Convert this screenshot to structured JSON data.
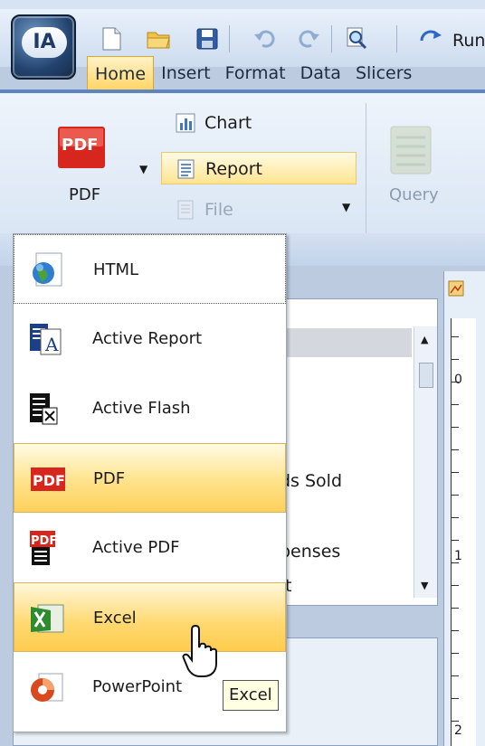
{
  "app": {
    "logo_text": "IA"
  },
  "quick_access": {
    "run_label": "Run",
    "icons": [
      "new-document-icon",
      "open-folder-icon",
      "save-icon",
      "undo-icon",
      "redo-icon",
      "search-document-icon",
      "run-icon"
    ]
  },
  "tabs": [
    {
      "label": "Home",
      "active": true
    },
    {
      "label": "Insert",
      "active": false
    },
    {
      "label": "Format",
      "active": false
    },
    {
      "label": "Data",
      "active": false
    },
    {
      "label": "Slicers",
      "active": false
    }
  ],
  "ribbon": {
    "pdf_label": "PDF",
    "pdf_icon_text": "PDF",
    "options": [
      {
        "label": "Chart",
        "state": "normal"
      },
      {
        "label": "Report",
        "state": "selected"
      },
      {
        "label": "File",
        "state": "disabled"
      }
    ],
    "query_label": "Query"
  },
  "menu": {
    "items": [
      {
        "label": "HTML",
        "icon": "globe-icon",
        "state": "focused"
      },
      {
        "label": "Active Report",
        "icon": "active-report-icon",
        "state": "normal"
      },
      {
        "label": "Active Flash",
        "icon": "active-flash-icon",
        "state": "normal"
      },
      {
        "label": "PDF",
        "icon": "pdf-icon",
        "state": "selected"
      },
      {
        "label": "Active PDF",
        "icon": "active-pdf-icon",
        "state": "normal"
      },
      {
        "label": "Excel",
        "icon": "excel-icon",
        "state": "hover"
      },
      {
        "label": "PowerPoint",
        "icon": "powerpoint-icon",
        "state": "normal"
      }
    ]
  },
  "background": {
    "list_fragments": [
      "ds Sold",
      "penses",
      "t"
    ],
    "ruler_numbers": [
      "0",
      "1",
      "2"
    ]
  },
  "tooltip": {
    "text": "Excel"
  },
  "colors": {
    "accent_blue": "#5d86bf",
    "highlight_gold": "#ffd465",
    "pdf_red": "#d7261e",
    "excel_green": "#2e8b2e"
  }
}
